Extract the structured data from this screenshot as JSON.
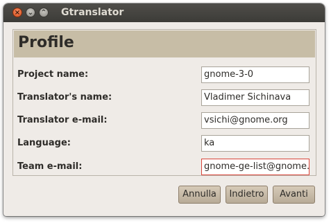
{
  "window": {
    "title": "Gtranslator"
  },
  "page": {
    "heading": "Profile"
  },
  "form": {
    "fields": [
      {
        "label": "Project name:",
        "value": "gnome-3-0"
      },
      {
        "label": "Translator's name:",
        "value": "Vladimer Sichinava"
      },
      {
        "label": "Translator e-mail:",
        "value": "vsichi@gnome.org"
      },
      {
        "label": "Language:",
        "value": "ka"
      },
      {
        "label": "Team e-mail:",
        "value": "gnome-ge-list@gnome."
      }
    ]
  },
  "buttons": {
    "cancel": "Annulla",
    "back": "Indietro",
    "forward": "Avanti"
  },
  "colors": {
    "titlebar": "#3c3b37",
    "header_band": "#c7bda6",
    "window_bg": "#efebe7",
    "close_button": "#e0612f",
    "focus_border": "#d8453a"
  }
}
